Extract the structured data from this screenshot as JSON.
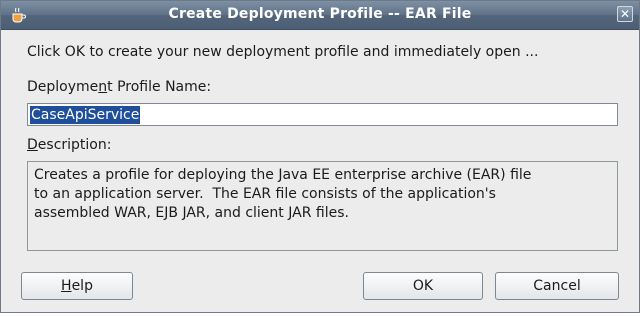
{
  "window": {
    "title": "Create Deployment Profile -- EAR File",
    "close_glyph": "✕",
    "app_icon": "coffee-cup-icon"
  },
  "intro_text": "Click OK to create your new deployment profile and immediately open ...",
  "profile_name": {
    "label_before": "Deployme",
    "label_mnemonic": "n",
    "label_after": "t Profile Name:",
    "value": "CaseApiService"
  },
  "description": {
    "label_mnemonic": "D",
    "label_after": "escription:",
    "text": "Creates a profile for deploying the Java EE enterprise archive (EAR) file\nto an application server.  The EAR file consists of the application's\nassembled WAR, EJB JAR, and client JAR files."
  },
  "buttons": {
    "help_mnemonic": "H",
    "help_after": "elp",
    "ok": "OK",
    "cancel": "Cancel"
  },
  "colors": {
    "titlebar": "#617388",
    "selection": "#1f4f9a"
  }
}
